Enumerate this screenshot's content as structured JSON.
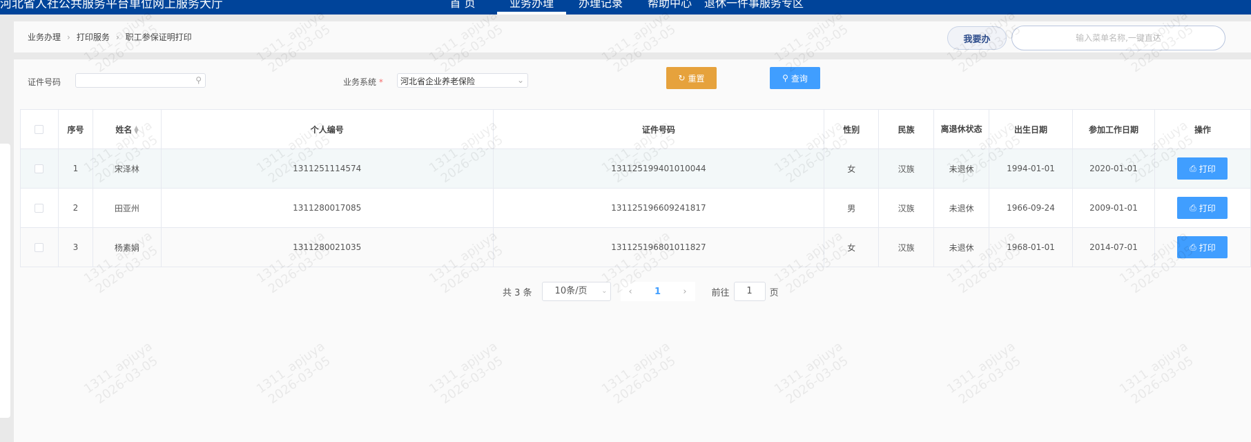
{
  "header": {
    "title": "河北省人社公共服务平台单位网上服务大厅",
    "nav": [
      "首 页",
      "业务办理",
      "办理记录",
      "帮助中心",
      "退休一件事服务专区"
    ],
    "active_nav": "业务办理",
    "color": "#00449a"
  },
  "breadcrumb": [
    "业务办理",
    "打印服务",
    "职工参保证明打印"
  ],
  "quick": {
    "want_label": "我要办",
    "search_placeholder": "输入菜单名称,一键直达"
  },
  "filters": {
    "id_label": "证件号码",
    "id_value": "",
    "system_label": "业务系统",
    "required_mark": "*",
    "system_value": "河北省企业养老保险",
    "reset_label": "重置",
    "query_label": "查询",
    "reset_color": "#e6a23c",
    "query_color": "#409eff"
  },
  "table": {
    "columns": [
      "序号",
      "姓名",
      "个人编号",
      "证件号码",
      "性别",
      "民族",
      "离退休状态",
      "出生日期",
      "参加工作日期",
      "操作"
    ],
    "rows": [
      {
        "no": "1",
        "name": "宋泽林",
        "pid": "1311251114574",
        "idno": "131125199401010044",
        "gender": "女",
        "nation": "汉族",
        "status": "未退休",
        "birth": "1994-01-01",
        "work": "2020-01-01",
        "action": "打印"
      },
      {
        "no": "2",
        "name": "田亚州",
        "pid": "1311280017085",
        "idno": "131125196609241817",
        "gender": "男",
        "nation": "汉族",
        "status": "未退休",
        "birth": "1966-09-24",
        "work": "2009-01-01",
        "action": "打印"
      },
      {
        "no": "3",
        "name": "杨素娟",
        "pid": "1311280021035",
        "idno": "131125196801011827",
        "gender": "女",
        "nation": "汉族",
        "status": "未退休",
        "birth": "1968-01-01",
        "work": "2014-07-01",
        "action": "打印"
      }
    ]
  },
  "pagination": {
    "total": "共 3 条",
    "page_size": "10条/页",
    "current": "1",
    "goto_label": "前往",
    "goto_value": "1",
    "page_unit": "页"
  },
  "watermark": "1311_apjuya\n2026-03-05"
}
